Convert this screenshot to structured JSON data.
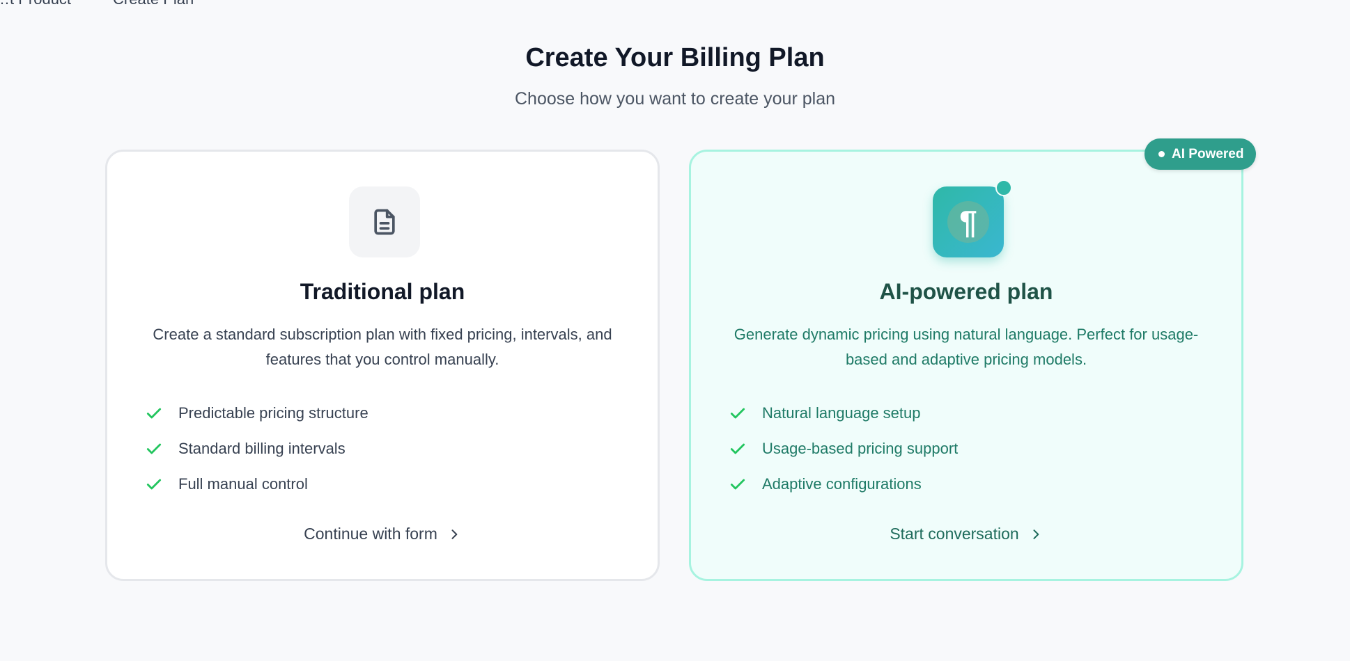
{
  "breadcrumb": {
    "items": [
      "…t Product",
      "Create Plan"
    ]
  },
  "header": {
    "title": "Create Your Billing Plan",
    "subtitle": "Choose how you want to create your plan"
  },
  "cards": {
    "traditional": {
      "icon": "document-icon",
      "title": "Traditional plan",
      "description": "Create a standard subscription plan with fixed pricing, intervals, and features that you control manually.",
      "features": [
        "Predictable pricing structure",
        "Standard billing intervals",
        "Full manual control"
      ],
      "cta": "Continue with form"
    },
    "ai": {
      "badge": "AI Powered",
      "icon": "pilcrow-icon",
      "icon_glyph": "¶",
      "title": "AI-powered plan",
      "description": "Generate dynamic pricing using natural language. Perfect for usage-based and adaptive pricing models.",
      "features": [
        "Natural language setup",
        "Usage-based pricing support",
        "Adaptive configurations"
      ],
      "cta": "Start conversation"
    }
  },
  "colors": {
    "accent": "#2f9e8c",
    "check": "#22c55e",
    "ai_text": "#1e7a66"
  }
}
